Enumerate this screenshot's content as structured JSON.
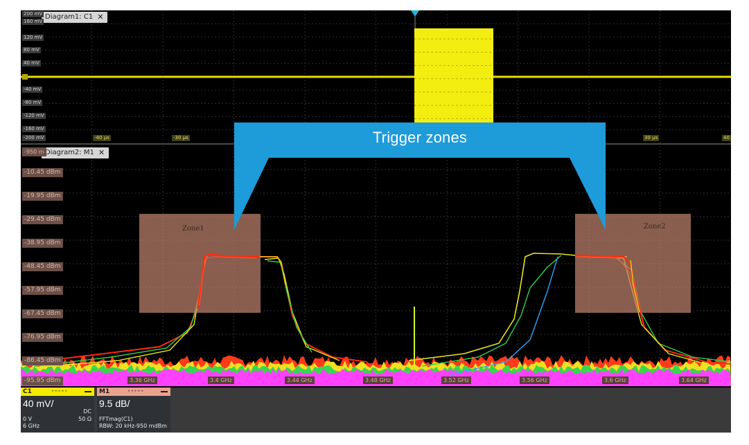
{
  "diagram1": {
    "tab_label": "Diagram1: C1",
    "close_glyph": "✕",
    "y_labels": [
      "200 mV",
      "160 mV",
      "120 mV",
      "80 mV",
      "40 mV",
      "",
      "-40 mV",
      "-80 mV",
      "-120 mV",
      "-160 mV",
      "-200 mV"
    ],
    "x_labels": [
      "-40 µs",
      "-30 µs",
      "30 µs",
      "40"
    ]
  },
  "diagram2": {
    "tab_label": "Diagram2: M1",
    "close_glyph": "✕",
    "top_label": "-950 m",
    "y_labels": [
      "-10.45 dBm",
      "-19.95 dBm",
      "-29.45 dBm",
      "-38.95 dBm",
      "-48.45 dBm",
      "-57.95 dBm",
      "-67.45 dBm",
      "-76.95 dBm",
      "-86.45 dBm",
      "-95.95 dBm"
    ],
    "x_labels": [
      "3.36 GHz",
      "3.4 GHz",
      "3.44 GHz",
      "3.48 GHz",
      "3.52 GHz",
      "3.56 GHz",
      "3.6 GHz",
      "3.64 GHz"
    ]
  },
  "zones": [
    {
      "label": "Zone1"
    },
    {
      "label": "Zone2"
    }
  ],
  "callout": {
    "text": "Trigger zones",
    "color": "#1e9bd9"
  },
  "channels": {
    "c1": {
      "name": "C1",
      "scale": "40 mV/",
      "coupling": "DC",
      "offset": "0 V",
      "impedance": "50 Ω",
      "bandwidth": "6 GHz",
      "color": "#f4ea00"
    },
    "m1": {
      "name": "M1",
      "scale": "9.5 dB/",
      "source": "FFTmag(C1)",
      "rbw": "RBW: 20 kHz-950 mdBm",
      "color": "#e8a38e"
    }
  }
}
